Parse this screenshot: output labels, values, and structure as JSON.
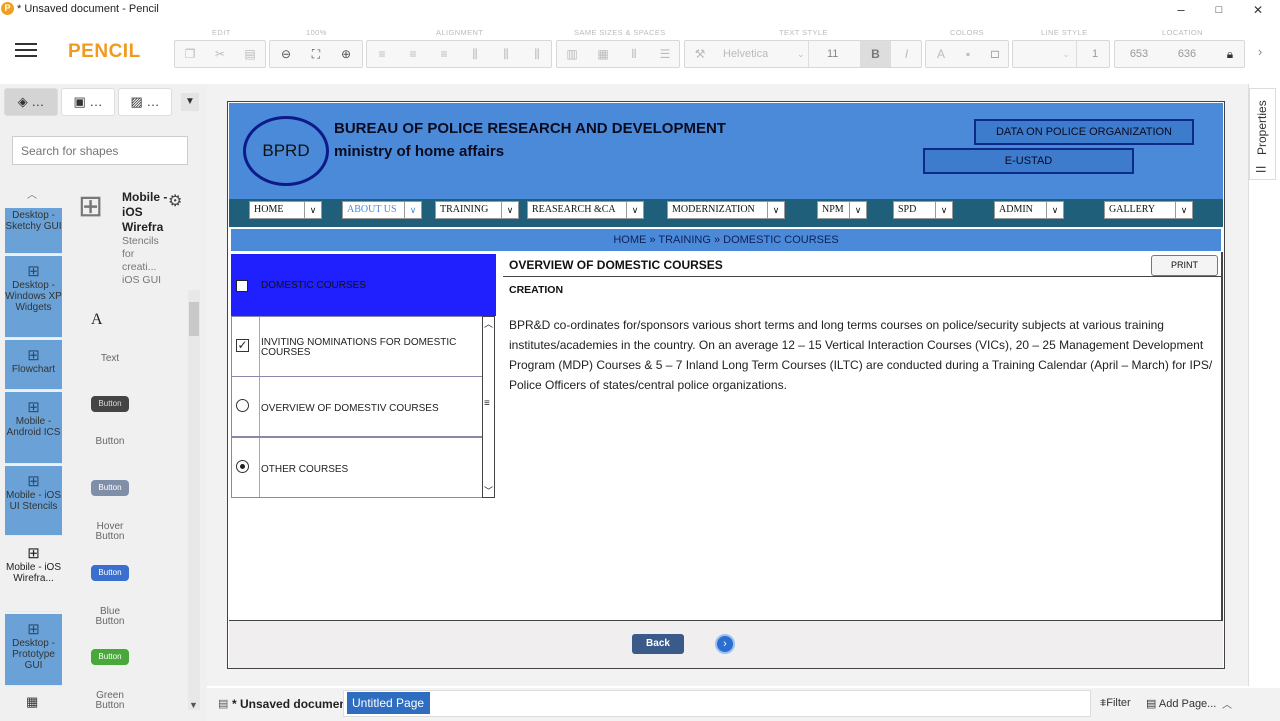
{
  "window": {
    "title": "* Unsaved document - Pencil",
    "minimize": "–",
    "maximize": "□",
    "close": "✕"
  },
  "app": {
    "name": "PENCIL"
  },
  "toolbar": {
    "groups": [
      "EDIT",
      "100%",
      "ALIGNMENT",
      "SAME SIZES & SPACES",
      "TEXT STYLE",
      "COLORS",
      "LINE STYLE",
      "LOCATION"
    ],
    "font_name": "Helvetica",
    "font_size": "11",
    "bold": "B",
    "italic": "I",
    "line_width": "1",
    "loc_x": "653",
    "loc_y": "636"
  },
  "left_panel": {
    "tabs": [
      "…",
      "…",
      "…"
    ],
    "search_placeholder": "Search for shapes",
    "collections": [
      "Desktop - Sketchy GUI",
      "Desktop - Windows XP Widgets",
      "Flowchart",
      "Mobile - Android ICS",
      "Mobile - iOS UI Stencils",
      "Mobile - iOS Wirefra...",
      "Desktop - Prototype GUI"
    ],
    "selected_collection": {
      "name": "Mobile - iOS Wirefra",
      "desc": "Stencils for creati... iOS GUI"
    },
    "shapes": [
      {
        "label": "Text",
        "sample": "A"
      },
      {
        "label": "Button",
        "sample": "Button"
      },
      {
        "label": "Hover Button",
        "sample": "Button"
      },
      {
        "label": "Blue Button",
        "sample": "Button"
      },
      {
        "label": "Green Button",
        "sample": "Button"
      }
    ]
  },
  "site": {
    "logo": "BPRD",
    "title": "BUREAU OF POLICE RESEARCH AND DEVELOPMENT",
    "subtitle": "ministry of home affairs",
    "btn_data": "DATA ON POLICE ORGANIZATION",
    "btn_eustad": "E-USTAD",
    "nav": [
      "HOME",
      "ABOUT US",
      "TRAINING",
      "REASEARCH &CA",
      "MODERNIZATION",
      "NPM",
      "SPD",
      "ADMIN",
      "GALLERY"
    ],
    "breadcrumb": "HOME » TRAINING » DOMESTIC COURSES",
    "menu": [
      "DOMESTIC COURSES",
      "INVITING NOMINATIONS FOR DOMESTIC COURSES",
      "OVERVIEW OF DOMESTIV COURSES",
      "OTHER COURSES"
    ],
    "content_title": "OVERVIEW OF DOMESTIC COURSES",
    "print": "PRINT",
    "section": "CREATION",
    "body": "BPR&D co-ordinates for/sponsors various short terms and long terms courses on police/security subjects at various training institutes/academies in the country. On an average 12 – 15 Vertical Interaction Courses (VICs), 20 – 25 Management Development Program (MDP) Courses & 5 – 7 Inland Long Term Courses (ILTC) are conducted during a Training Calendar (April – March) for IPS/ Police Officers of states/central police organizations.",
    "back": "Back"
  },
  "right_panel": {
    "label": "Properties"
  },
  "bottom": {
    "doc": "* Unsaved document",
    "page_tab": "Untitled Page",
    "filter": "Filter",
    "add_page": "Add Page..."
  }
}
